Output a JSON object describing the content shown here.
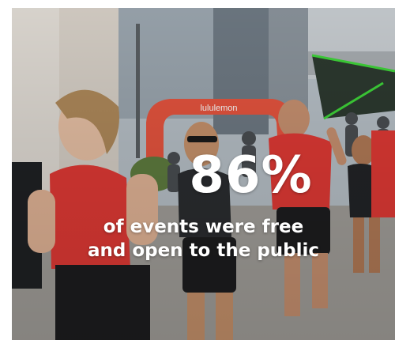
{
  "stat": {
    "value": "86%",
    "caption_line1": "of events were free",
    "caption_line2": "and open to the public"
  },
  "photo": {
    "arch_text": "lululemon",
    "icons": [
      "running-crowd-photo",
      "event-arch"
    ]
  },
  "colors": {
    "arch": "#e8553f",
    "shirt_red": "#e23a35",
    "text": "#ffffff",
    "accent_green": "#3fd63a"
  }
}
